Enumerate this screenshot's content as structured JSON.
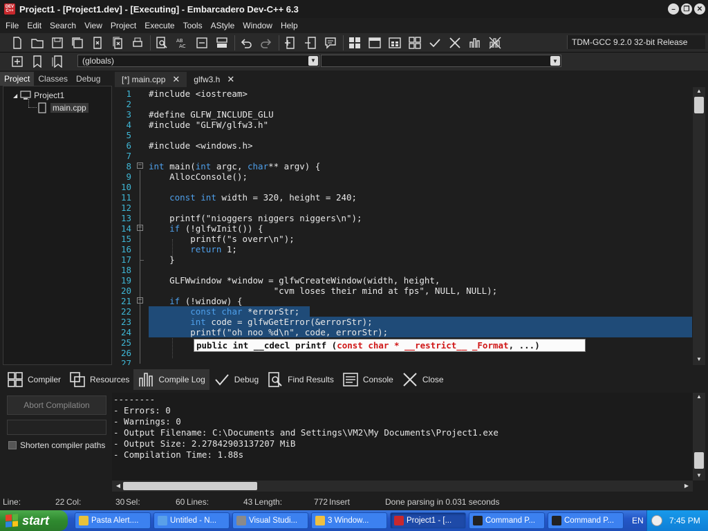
{
  "window": {
    "title": "Project1 - [Project1.dev] - [Executing] - Embarcadero Dev-C++ 6.3",
    "logo_text": "DEV C++",
    "controls": [
      "–",
      "❐",
      "✕"
    ]
  },
  "menu": [
    "File",
    "Edit",
    "Search",
    "View",
    "Project",
    "Execute",
    "Tools",
    "AStyle",
    "Window",
    "Help"
  ],
  "toolbar": {
    "compiler": "TDM-GCC 9.2.0 32-bit Release",
    "globals": "(globals)"
  },
  "left_panel": {
    "tabs": [
      "Project",
      "Classes",
      "Debug"
    ],
    "tree": {
      "project": "Project1",
      "file": "main.cpp"
    }
  },
  "editor": {
    "tabs": [
      {
        "label": "[*] main.cpp",
        "close": "✕"
      },
      {
        "label": "glfw3.h",
        "close": "✕"
      }
    ],
    "line_numbers": [
      "1",
      "2",
      "3",
      "4",
      "5",
      "6",
      "7",
      "8",
      "9",
      "10",
      "11",
      "12",
      "13",
      "14",
      "15",
      "16",
      "17",
      "18",
      "19",
      "20",
      "21",
      "22",
      "23",
      "24",
      "25",
      "26",
      "27"
    ],
    "lines": [
      "#include <iostream>",
      "",
      "#define GLFW_INCLUDE_GLU",
      "#include \"GLFW/glfw3.h\"",
      "",
      "#include <windows.h>",
      "",
      "int main(int argc, char** argv) {",
      "    AllocConsole();",
      "",
      "    const int width = 320, height = 240;",
      "",
      "    printf(\"nioggers niggers niggers\\n\");",
      "    if (!glfwInit()) {",
      "        printf(\"s overr\\n\");",
      "        return 1;",
      "    }",
      "",
      "    GLFWwindow *window = glfwCreateWindow(width, height,",
      "                        \"cvm loses their mind at fps\", NULL, NULL);",
      "    if (!window) {",
      "        const char *errorStr;",
      "        int code = glfwGetError(&errorStr);",
      "        printf(\"oh noo %d\\n\", code, errorStr);",
      "",
      "",
      ""
    ],
    "tooltip": {
      "part1": "public int __cdecl printf (",
      "part2": "const char * __restrict__ _Format",
      "part3": ", ...)"
    }
  },
  "bottom_tabs": [
    "Compiler",
    "Resources",
    "Compile Log",
    "Debug",
    "Find Results",
    "Console",
    "Close"
  ],
  "compile_panel": {
    "abort_label": "Abort Compilation",
    "shorten_label": "Shorten compiler paths",
    "log": [
      "--------",
      "- Errors: 0",
      "- Warnings: 0",
      "- Output Filename: C:\\Documents and Settings\\VM2\\My Documents\\Project1.exe",
      "- Output Size: 2.27842903137207 MiB",
      "- Compilation Time: 1.88s"
    ]
  },
  "status": {
    "line_label": "Line:",
    "line_value": "22",
    "col_label": "Col:",
    "col_value": "30",
    "sel_label": "Sel:",
    "sel_value": "60",
    "lines_label": "Lines:",
    "lines_value": "43",
    "length_label": "Length:",
    "length_value": "772",
    "mode": "Insert",
    "parse_msg": "Done parsing in 0.031 seconds"
  },
  "taskbar": {
    "start": "start",
    "items": [
      {
        "label": "Pasta Alert....",
        "color": "#e8c23a"
      },
      {
        "label": "Untitled - N...",
        "color": "#5aa0e8"
      },
      {
        "label": "Visual Studi...",
        "color": "#8a8a8a"
      },
      {
        "label": "3 Window...",
        "color": "#f0c040"
      },
      {
        "label": "Project1 - [...",
        "color": "#c8282d"
      },
      {
        "label": "Command P...",
        "color": "#222222"
      },
      {
        "label": "Command P...",
        "color": "#222222"
      }
    ],
    "lang": "EN",
    "time": "7:45 PM"
  }
}
